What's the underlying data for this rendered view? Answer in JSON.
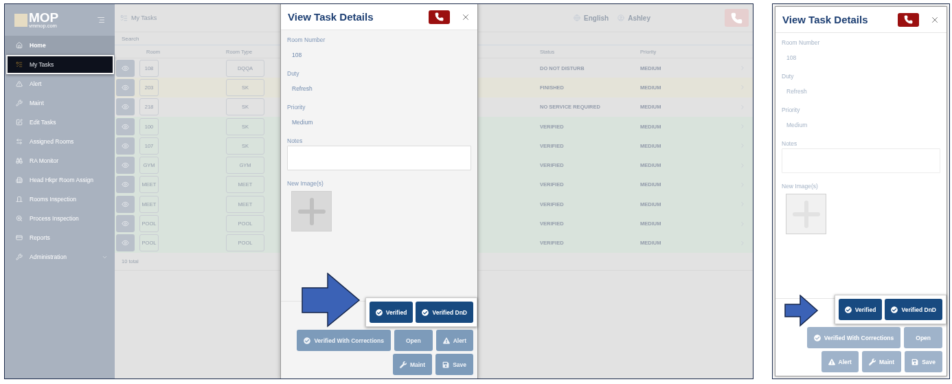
{
  "app_screen": {
    "logo": {
      "mark": "MOP",
      "domain": "vmmop.com"
    },
    "sidebar": {
      "items": [
        {
          "label": "Home",
          "selected": true,
          "highlighted": false,
          "has_submenu": false
        },
        {
          "label": "My Tasks",
          "selected": false,
          "highlighted": true,
          "has_submenu": false
        },
        {
          "label": "Alert",
          "selected": false,
          "highlighted": false,
          "has_submenu": false
        },
        {
          "label": "Maint",
          "selected": false,
          "highlighted": false,
          "has_submenu": false
        },
        {
          "label": "Edit Tasks",
          "selected": false,
          "highlighted": false,
          "has_submenu": false
        },
        {
          "label": "Assigned Rooms",
          "selected": false,
          "highlighted": false,
          "has_submenu": false
        },
        {
          "label": "RA Monitor",
          "selected": false,
          "highlighted": false,
          "has_submenu": false
        },
        {
          "label": "Head Hkpr Room Assign",
          "selected": false,
          "highlighted": false,
          "has_submenu": false
        },
        {
          "label": "Rooms Inspection",
          "selected": false,
          "highlighted": false,
          "has_submenu": false
        },
        {
          "label": "Process Inspection",
          "selected": false,
          "highlighted": false,
          "has_submenu": false
        },
        {
          "label": "Reports",
          "selected": false,
          "highlighted": false,
          "has_submenu": false
        },
        {
          "label": "Administration",
          "selected": false,
          "highlighted": false,
          "has_submenu": true
        }
      ]
    },
    "header": {
      "title": "My Tasks",
      "language": "English",
      "user": "Ashley"
    },
    "search": {
      "placeholder": "Search"
    },
    "table": {
      "columns": [
        "Room",
        "Room Type",
        "Status",
        "Priority"
      ],
      "rows": [
        {
          "room": "108",
          "room_type": "DQQA",
          "status": "DO NOT DISTURB",
          "priority": "MEDIUM",
          "color": "#e2e2e2"
        },
        {
          "room": "203",
          "room_type": "SK",
          "status": "FINISHED",
          "priority": "MEDIUM",
          "color": "#e4e3d8"
        },
        {
          "room": "218",
          "room_type": "SK",
          "status": "NO SERVICE REQUIRED",
          "priority": "MEDIUM",
          "color": "#e2e2e2"
        },
        {
          "room": "100",
          "room_type": "SK",
          "status": "VERIFIED",
          "priority": "MEDIUM",
          "color": "#d9e3dc"
        },
        {
          "room": "107",
          "room_type": "SK",
          "status": "VERIFIED",
          "priority": "MEDIUM",
          "color": "#d9e3dc"
        },
        {
          "room": "GYM",
          "room_type": "GYM",
          "status": "VERIFIED",
          "priority": "MEDIUM",
          "color": "#d9e3dc"
        },
        {
          "room": "MEET",
          "room_type": "MEET",
          "status": "VERIFIED",
          "priority": "MEDIUM",
          "color": "#d9e3dc"
        },
        {
          "room": "MEET",
          "room_type": "MEET",
          "status": "VERIFIED",
          "priority": "MEDIUM",
          "color": "#d9e3dc"
        },
        {
          "room": "POOL",
          "room_type": "POOL",
          "status": "VERIFIED",
          "priority": "MEDIUM",
          "color": "#d9e3dc"
        },
        {
          "room": "POOL",
          "room_type": "POOL",
          "status": "VERIFIED",
          "priority": "MEDIUM",
          "color": "#d9e3dc"
        }
      ],
      "footer": "10 total"
    },
    "modal": {
      "title": "View Task Details",
      "disabled": false,
      "fields": [
        {
          "label": "Room Number",
          "value": "108"
        },
        {
          "label": "Duty",
          "value": "Refresh"
        },
        {
          "label": "Priority",
          "value": "Medium"
        }
      ],
      "notes_label": "Notes",
      "images_label": "New Image(s)",
      "button_rows": [
        {
          "callout": true,
          "buttons": [
            {
              "label": "Verified",
              "kind": "verify"
            },
            {
              "label": "Verified DnD",
              "kind": "verify"
            }
          ]
        },
        {
          "callout": false,
          "buttons": [
            {
              "label": "Verified With Corrections",
              "kind": "verify"
            },
            {
              "label": "Open",
              "kind": "plain"
            },
            {
              "label": "Alert",
              "kind": "alert"
            }
          ]
        },
        {
          "callout": false,
          "buttons": [
            {
              "label": "Maint",
              "kind": "maint"
            },
            {
              "label": "Save",
              "kind": "save"
            }
          ]
        }
      ]
    }
  },
  "detail_panel": {
    "modal": {
      "title": "View Task Details",
      "disabled": true,
      "fields": [
        {
          "label": "Room Number",
          "value": "108"
        },
        {
          "label": "Duty",
          "value": "Refresh"
        },
        {
          "label": "Priority",
          "value": "Medium"
        }
      ],
      "notes_label": "Notes",
      "images_label": "New Image(s)",
      "button_rows": [
        {
          "callout": true,
          "buttons": [
            {
              "label": "Verified",
              "kind": "verify"
            },
            {
              "label": "Verified DnD",
              "kind": "verify"
            }
          ]
        },
        {
          "callout": false,
          "buttons": [
            {
              "label": "Verified With Corrections",
              "kind": "verify"
            },
            {
              "label": "Open",
              "kind": "plain"
            }
          ]
        },
        {
          "callout": false,
          "buttons": [
            {
              "label": "Alert",
              "kind": "alert"
            },
            {
              "label": "Maint",
              "kind": "maint"
            },
            {
              "label": "Save",
              "kind": "save"
            }
          ]
        }
      ]
    }
  }
}
